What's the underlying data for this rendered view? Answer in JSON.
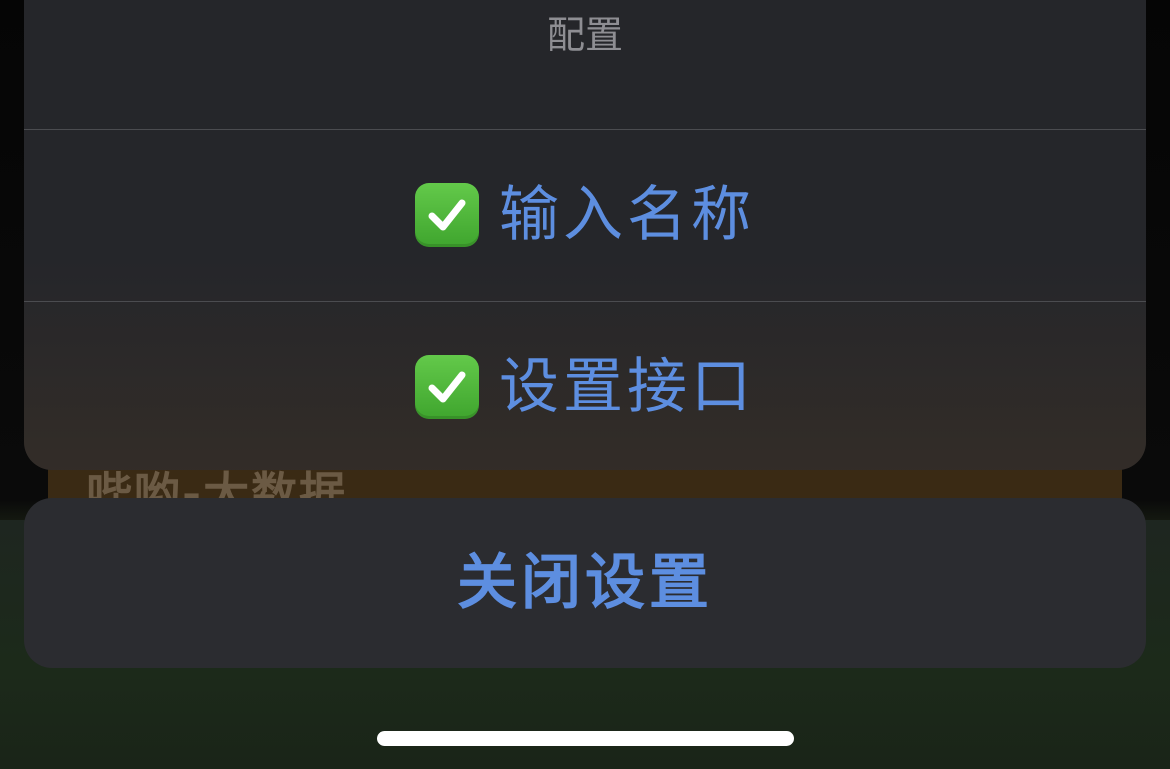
{
  "background": {
    "strip_text": "哔哟-大数据"
  },
  "sheet": {
    "title": "配置",
    "actions": [
      {
        "icon": "checkmark-icon",
        "label": "输入名称"
      },
      {
        "icon": "checkmark-icon",
        "label": "设置接口"
      }
    ],
    "cancel_label": "关闭设置"
  },
  "colors": {
    "accent": "#5d8ee0",
    "sheet_bg": "#25262a",
    "title_text": "#8e8e93",
    "check_green": "#4cb83a"
  }
}
